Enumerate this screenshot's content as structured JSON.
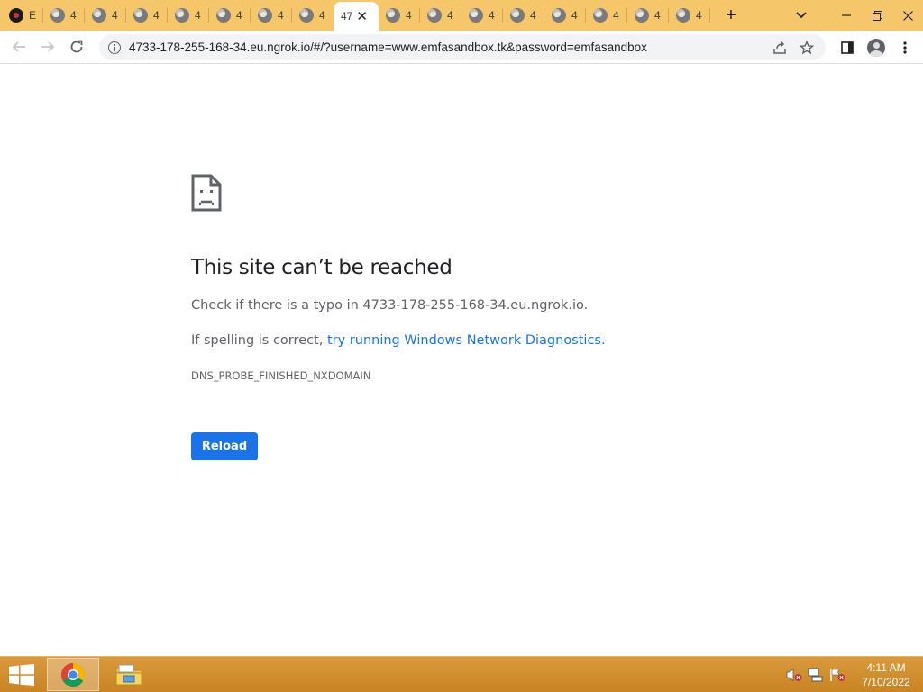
{
  "browser": {
    "tabs": [
      {
        "favicon": "app-favicon-dark-icon",
        "title": "E",
        "active": false
      },
      {
        "favicon": "globe-icon",
        "title": "4",
        "active": false
      },
      {
        "favicon": "globe-icon",
        "title": "4",
        "active": false
      },
      {
        "favicon": "globe-icon",
        "title": "4",
        "active": false
      },
      {
        "favicon": "globe-icon",
        "title": "4",
        "active": false
      },
      {
        "favicon": "globe-icon",
        "title": "4",
        "active": false
      },
      {
        "favicon": "globe-icon",
        "title": "4",
        "active": false
      },
      {
        "favicon": "globe-icon",
        "title": "4",
        "active": false
      },
      {
        "favicon": "none",
        "title": "47",
        "active": true
      },
      {
        "favicon": "globe-icon",
        "title": "4",
        "active": false
      },
      {
        "favicon": "globe-icon",
        "title": "4",
        "active": false
      },
      {
        "favicon": "globe-icon",
        "title": "4",
        "active": false
      },
      {
        "favicon": "globe-icon",
        "title": "4",
        "active": false
      },
      {
        "favicon": "globe-icon",
        "title": "4",
        "active": false
      },
      {
        "favicon": "globe-icon",
        "title": "4",
        "active": false
      },
      {
        "favicon": "globe-icon",
        "title": "4",
        "active": false
      },
      {
        "favicon": "globe-icon",
        "title": "4",
        "active": false
      }
    ],
    "tab_close_glyph": "✕",
    "new_tab_glyph": "+",
    "url": "4733-178-255-168-34.eu.ngrok.io/#/?username=www.emfasandbox.tk&password=emfasandbox",
    "colors": {
      "tabstrip": "#f6c76a",
      "omnibox": "#f1f3f4",
      "accent": "#1a73e8"
    }
  },
  "error_page": {
    "title": "This site can’t be reached",
    "line1": "Check if there is a typo in 4733-178-255-168-34.eu.ngrok.io.",
    "line2_prefix": "If spelling is correct, ",
    "line2_link": "try running Windows Network Diagnostics",
    "line2_suffix": ".",
    "error_code": "DNS_PROBE_FINISHED_NXDOMAIN",
    "reload_label": "Reload"
  },
  "taskbar": {
    "time": "4:11 AM",
    "date": "7/10/2022",
    "apps": [
      "chrome-icon",
      "file-explorer-icon"
    ],
    "tray": [
      "volume-muted-icon",
      "network-icon",
      "action-center-flag-icon"
    ]
  }
}
